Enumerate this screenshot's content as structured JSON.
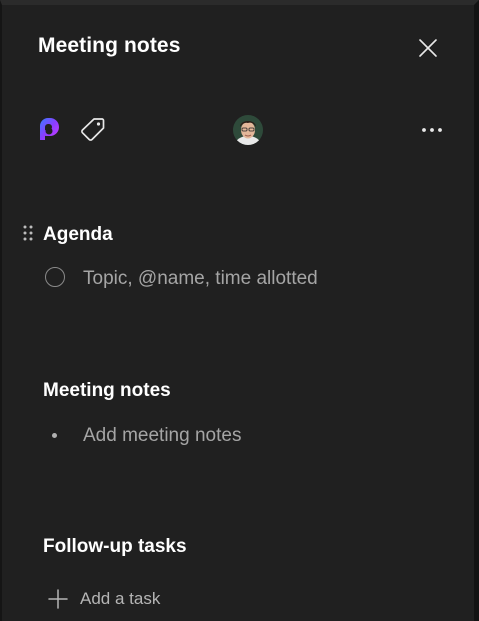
{
  "panel": {
    "title": "Meeting notes",
    "accent_color": "#7b4dff"
  },
  "toolbar": {
    "loop_icon": "loop-app-icon",
    "tag_icon": "tag-icon",
    "avatar_icon": "user-avatar",
    "more_icon": "more-horizontal-icon"
  },
  "sections": {
    "agenda": {
      "heading": "Agenda",
      "placeholder": "Topic, @name, time allotted"
    },
    "meeting_notes": {
      "heading": "Meeting notes",
      "placeholder": "Add meeting notes"
    },
    "follow_up": {
      "heading": "Follow-up tasks",
      "add_task_label": "Add a task"
    }
  }
}
